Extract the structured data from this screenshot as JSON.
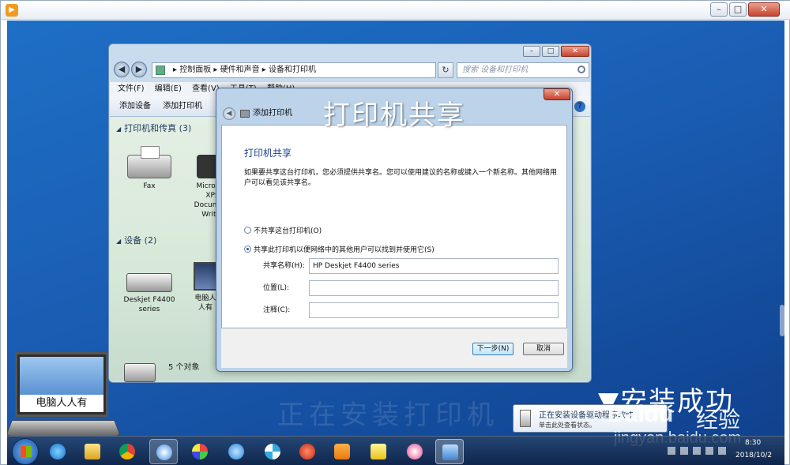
{
  "player": {
    "title_icon": "play-icon"
  },
  "explorer": {
    "breadcrumb": [
      "控制面板",
      "硬件和声音",
      "设备和打印机"
    ],
    "search_placeholder": "搜索 设备和打印机",
    "menu": [
      "文件(F)",
      "编辑(E)",
      "查看(V)",
      "工具(T)",
      "帮助(H)"
    ],
    "toolbar": [
      "添加设备",
      "添加打印机"
    ],
    "groups": {
      "printers_header": "打印机和传真 (3)",
      "devices_header": "设备 (2)"
    },
    "items": {
      "fax": "Fax",
      "xps": "Microsoft XPS Document Writer",
      "deskjet": "Deskjet F4400 series",
      "pc": "电脑人人有"
    },
    "object_count": "5 个对象"
  },
  "dialog": {
    "title": "添加打印机",
    "heading": "打印机共享",
    "description": "如果要共享这台打印机，您必须提供共享名。您可以使用建议的名称或键入一个新名称。其他网络用户可以看见该共享名。",
    "radio_no_share": "不共享这台打印机(O)",
    "radio_share": "共享此打印机以便网络中的其他用户可以找到并使用它(S)",
    "share_name_label": "共享名称(H):",
    "share_name_value": "HP Deskjet F4400 series",
    "location_label": "位置(L):",
    "location_value": "",
    "comment_label": "注释(C):",
    "comment_value": "",
    "next_button": "下一步(N)",
    "cancel_button": "取消"
  },
  "captions": {
    "top": "打印机共享",
    "success": "▼安装成功",
    "watermark": "正在安装打印机"
  },
  "notification": {
    "title": "正在安装设备驱动程序软件",
    "subtitle": "单击此处查看状态。"
  },
  "baidu": {
    "brand": "Baidu",
    "jingyan": "经验",
    "url": "jingyan.baidu.com"
  },
  "logo_text": "电脑人人有",
  "taskbar": {
    "time": "8:30",
    "date": "2018/10/2"
  }
}
